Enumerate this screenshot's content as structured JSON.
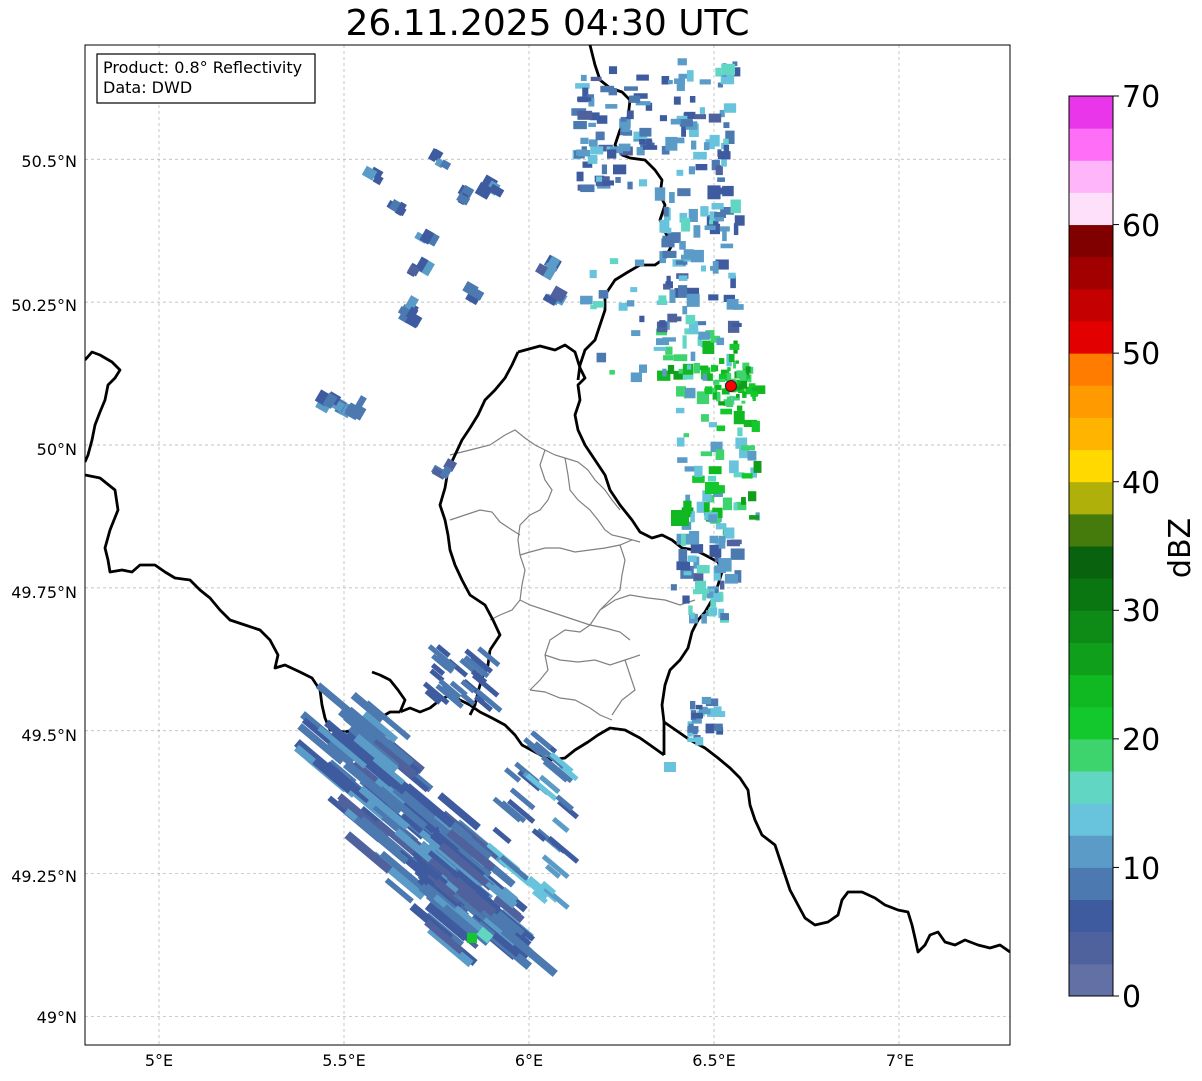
{
  "title": "26.11.2025 04:30 UTC",
  "info_box": {
    "product": "Product: 0.8° Reflectivity",
    "data": "Data: DWD"
  },
  "axes": {
    "x_ticks": [
      "5°E",
      "5.5°E",
      "6°E",
      "6.5°E",
      "7°E"
    ],
    "y_ticks": [
      "50.5°N",
      "50.25°N",
      "50°N",
      "49.75°N",
      "49.5°N",
      "49.25°N",
      "49°N"
    ],
    "grid": true,
    "lon_range": [
      4.8,
      7.3
    ],
    "lat_range": [
      48.95,
      50.7
    ]
  },
  "colorbar": {
    "label": "dBZ",
    "ticks": [
      "0",
      "10",
      "20",
      "30",
      "40",
      "50",
      "60",
      "70"
    ],
    "range": [
      0,
      70
    ],
    "step": 2.5,
    "colors": [
      "#6270a6",
      "#4f629e",
      "#3e5ba0",
      "#4b79b0",
      "#5a9bc7",
      "#68c3dc",
      "#61d6c3",
      "#3dd46e",
      "#12c82c",
      "#10b821",
      "#0f9f1b",
      "#0e8a17",
      "#0a7612",
      "#08620e",
      "#457a0c",
      "#afb00a",
      "#ffd900",
      "#ffb400",
      "#ff9a00",
      "#ff7c00",
      "#e30000",
      "#c40000",
      "#a20000",
      "#800000",
      "#ffe0fa",
      "#ffb5fa",
      "#ff6ef7",
      "#ea36ea"
    ]
  },
  "map": {
    "radar_site_color": "#ff0000"
  }
}
